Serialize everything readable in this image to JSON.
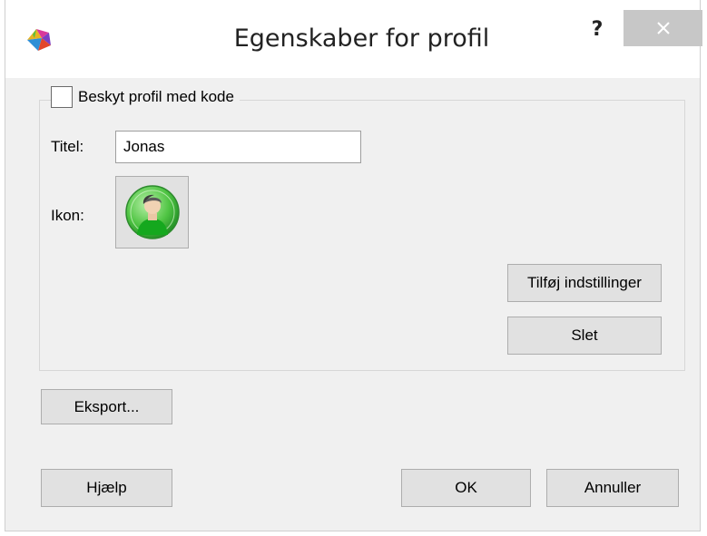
{
  "window": {
    "title": "Egenskaber for profil",
    "help_label": "?"
  },
  "protect": {
    "label": "Beskyt profil med kode",
    "checked": false
  },
  "titel": {
    "label": "Titel:",
    "value": "Jonas"
  },
  "ikon": {
    "label": "Ikon:",
    "icon": "user-avatar-icon"
  },
  "buttons": {
    "add_settings": "Tilføj indstillinger",
    "delete": "Slet",
    "export": "Eksport...",
    "help": "Hjælp",
    "ok": "OK",
    "cancel": "Annuller"
  },
  "colors": {
    "dialog_bg": "#f0f0f0",
    "close_btn_bg": "#c7c7c7",
    "avatar_green": "#3fbf3a"
  }
}
